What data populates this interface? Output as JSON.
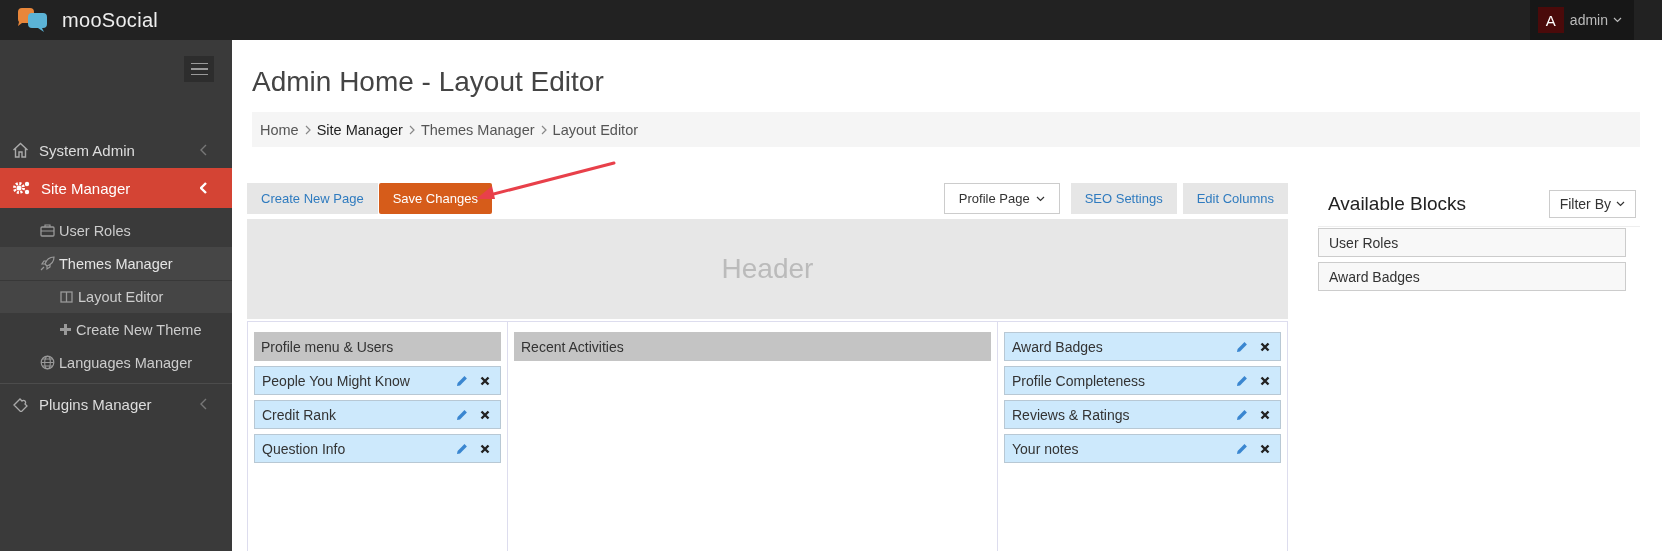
{
  "topbar": {
    "brand": "mooSocial",
    "user": {
      "initial": "A",
      "name": "admin"
    }
  },
  "sidebar": {
    "items": [
      {
        "label": "System Admin",
        "selected": false
      },
      {
        "label": "Site Manager",
        "selected": true,
        "expanded": true,
        "children": [
          {
            "label": "User Roles"
          },
          {
            "label": "Themes Manager",
            "expanded": true,
            "children": [
              {
                "label": "Layout Editor",
                "selected": true
              },
              {
                "label": "Create New Theme",
                "selected": false
              }
            ]
          },
          {
            "label": "Languages Manager"
          }
        ]
      },
      {
        "label": "Plugins Manager",
        "selected": false
      }
    ]
  },
  "page_title": "Admin Home - Layout Editor",
  "breadcrumb": [
    {
      "label": "Home",
      "current": false
    },
    {
      "label": "Site Manager",
      "current": true
    },
    {
      "label": "Themes Manager",
      "current": false
    },
    {
      "label": "Layout Editor",
      "current": false
    }
  ],
  "toolbar": {
    "left": [
      {
        "label": "Create New Page",
        "kind": "plain"
      },
      {
        "label": "Save Changes",
        "kind": "primary"
      }
    ],
    "right": [
      {
        "label": "Profile Page",
        "kind": "dropdown"
      },
      {
        "label": "SEO Settings",
        "kind": "plain"
      },
      {
        "label": "Edit Columns",
        "kind": "plain"
      }
    ]
  },
  "header_region": "Header",
  "columns": [
    {
      "title": "Profile menu & Users",
      "blocks": [
        "People You Might Know",
        "Credit Rank",
        "Question Info"
      ]
    },
    {
      "title": "Recent Activities"
    },
    {
      "blocks": [
        "Award Badges",
        "Profile Completeness",
        "Reviews & Ratings",
        "Your notes"
      ]
    }
  ],
  "available": {
    "title": "Available Blocks",
    "filter": "Filter By",
    "blocks": [
      "User Roles",
      "Award Badges"
    ]
  }
}
